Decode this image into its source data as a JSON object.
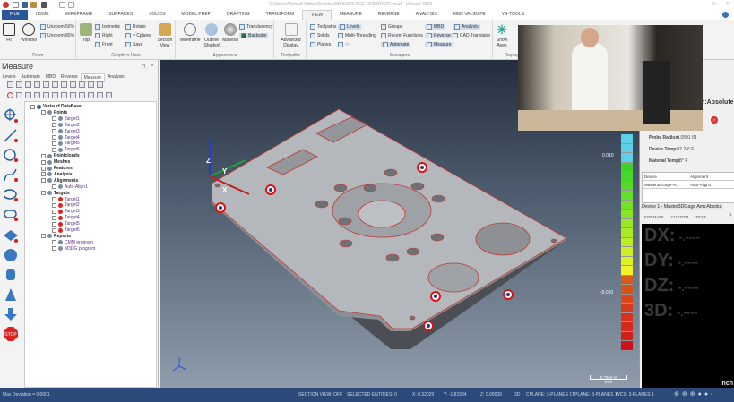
{
  "window": {
    "title": "C:\\Users\\Verisurf Admin\\Desktop\\MKS\\3DGAGE DEMOPART.vsurf - Verisurf 2019"
  },
  "ribbon_tabs": [
    "FILE",
    "HOME",
    "WIREFRAME",
    "SURFACES",
    "SOLIDS",
    "MODEL PREP",
    "DRAFTING",
    "TRANSFORM",
    "VIEW",
    "MEASURE",
    "REVERSE",
    "ANALYSIS",
    "MBD VALIDATE",
    "VS-TOOLS"
  ],
  "active_tab": "VIEW",
  "ribbon": {
    "zoom": {
      "label": "Zoom",
      "fit": "Fit",
      "window": "Window",
      "unzoom50": "Unzoom 50%",
      "unzoom80": "Unzoom 80%"
    },
    "graphics_view": {
      "label": "Graphics View",
      "top": "Top",
      "isometric": "Isometric",
      "right": "Right",
      "front": "Front",
      "rotate": "Rotate",
      "cplane": "= Cplane",
      "save": "Save",
      "section_view": "Section View"
    },
    "appearance": {
      "label": "Appearance",
      "wireframe": "Wireframe",
      "outline_shaded": "Outline Shaded",
      "material": "Material",
      "translucency": "Translucency",
      "backside": "Backside"
    },
    "toolpaths": {
      "label": "Toolpaths",
      "advanced_display": "Advanced Display"
    },
    "managers": {
      "label": "Managers",
      "items": [
        "Toolpaths",
        "Solids",
        "Planes",
        "Levels",
        "Multi-Threading",
        "Art",
        "Groups",
        "Recent Functions",
        "Automate",
        "MBD",
        "Reverse",
        "Measure",
        "Analysis",
        "CAD Translator"
      ]
    },
    "display": {
      "label": "Display",
      "show_axes": "Show Axes"
    }
  },
  "left_panel": {
    "title": "Measure",
    "tabs": [
      "Levels",
      "Automate",
      "MBD",
      "Reverse",
      "Measure",
      "Analysis"
    ],
    "active_tab": "Measure",
    "tree": [
      {
        "label": "Verisurf DataBase",
        "level": 0,
        "bold": true
      },
      {
        "label": "Points",
        "level": 1,
        "bold": true
      },
      {
        "label": "Target1",
        "level": 2
      },
      {
        "label": "Target2",
        "level": 2
      },
      {
        "label": "Target3",
        "level": 2
      },
      {
        "label": "Target4",
        "level": 2
      },
      {
        "label": "Target5",
        "level": 2
      },
      {
        "label": "Target6",
        "level": 2
      },
      {
        "label": "Pointclouds",
        "level": 1,
        "bold": true
      },
      {
        "label": "Meshes",
        "level": 1,
        "bold": true
      },
      {
        "label": "Features",
        "level": 1,
        "bold": true
      },
      {
        "label": "Analysis",
        "level": 1,
        "bold": true
      },
      {
        "label": "Alignments",
        "level": 1,
        "bold": true
      },
      {
        "label": "Auto-Align1",
        "level": 2
      },
      {
        "label": "Targets",
        "level": 1,
        "bold": true
      },
      {
        "label": "Target1",
        "level": 2
      },
      {
        "label": "Target2",
        "level": 2
      },
      {
        "label": "Target3",
        "level": 2
      },
      {
        "label": "Target4",
        "level": 2
      },
      {
        "label": "Target5",
        "level": 2
      },
      {
        "label": "Target6",
        "level": 2
      },
      {
        "label": "Reports",
        "level": 1,
        "bold": true
      },
      {
        "label": "CMM program",
        "level": 2
      },
      {
        "label": "M3DG program",
        "level": 2
      }
    ]
  },
  "viewport": {
    "axis_x": "X",
    "axis_y": "Y",
    "axis_z": "Z",
    "scale_upper": "0.010",
    "scale_lower": "-0.010",
    "scale_bar_value": "0.7960 in",
    "scale_bar_unit": "Inch"
  },
  "right_panel": {
    "mode": "n:Absolute",
    "probe_radius_label": "Probe Radius:",
    "probe_radius": "0.0591 IN",
    "device_temp_label": "Device Temp:",
    "device_temp": "82.74° F",
    "material_temp_label": "Material Temp:",
    "material_temp": "68° F",
    "table_headers": [
      "Device",
      "Alignment"
    ],
    "table_row": [
      "Master3DGage Ar...",
      "Auto-Align1"
    ],
    "device_title": "Device 1 - Master3DGage Arm:Absolut",
    "device_tabs": [
      "FORMATS",
      "CUSTOM",
      "TEXT"
    ],
    "dro": [
      {
        "label": "DX:",
        "value": "-.----"
      },
      {
        "label": "DY:",
        "value": "-.----"
      },
      {
        "label": "DZ:",
        "value": "-.----"
      },
      {
        "label": "3D:",
        "value": "-.----"
      }
    ],
    "unit": "inch"
  },
  "status": {
    "left": "Max Deviation = 0.0001",
    "section_view": "SECTION VIEW: OFF",
    "selected": "SELECTED ENTITIES: 0",
    "x": "X:  0.32029",
    "y": "Y:  -1.81534",
    "z": "Z:  0.00000",
    "mode": "3D",
    "cplane": "CPLANE: 3-PLANES 1",
    "tplane": "TPLANE: 3-PLANES 1",
    "wcs": "WCS: 3-PLANES 1"
  }
}
